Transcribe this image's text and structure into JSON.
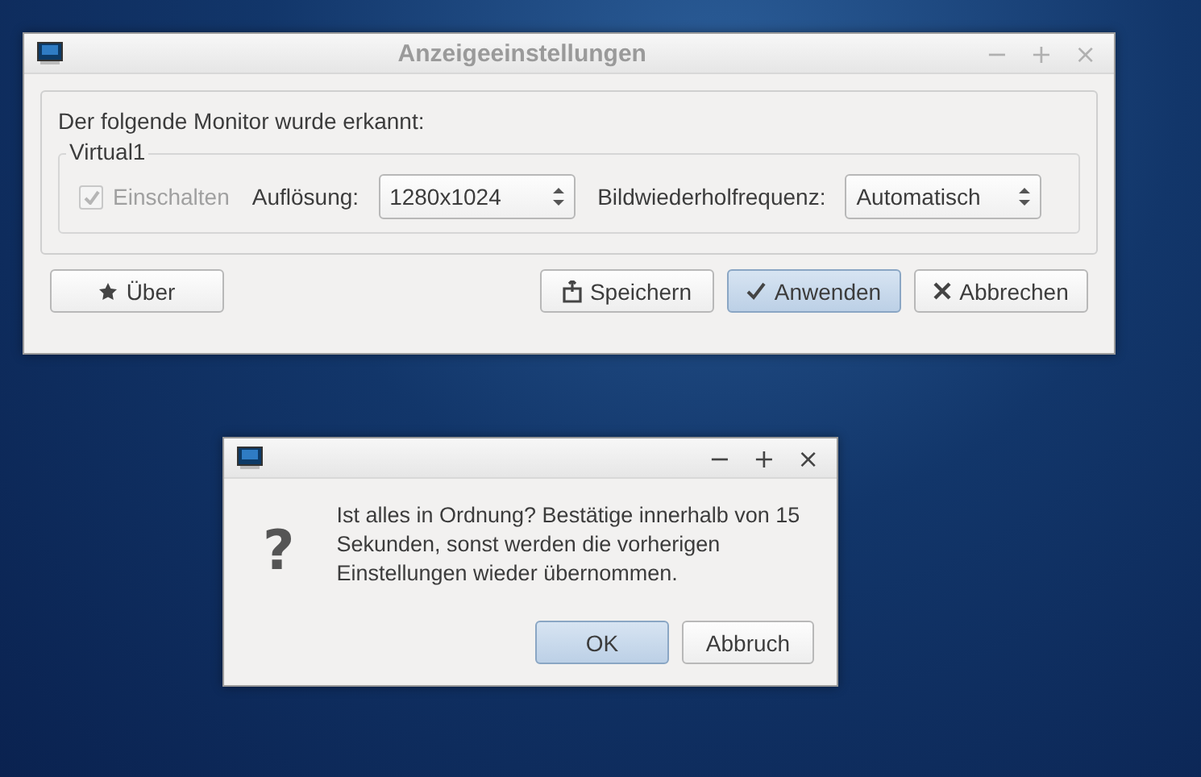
{
  "main_window": {
    "title": "Anzeigeeinstellungen",
    "window_controls": [
      "−",
      "+",
      "×"
    ],
    "detected_label": "Der folgende Monitor wurde erkannt:",
    "monitor": {
      "name": "Virtual1",
      "enable": {
        "label": "Einschalten",
        "checked": true,
        "disabled": true
      },
      "resolution": {
        "label": "Auflösung:",
        "value": "1280x1024"
      },
      "refresh_rate": {
        "label": "Bildwiederholfrequenz:",
        "value": "Automatisch"
      }
    },
    "buttons": [
      {
        "kind": "about",
        "label": "Über",
        "default": false
      },
      {
        "kind": "save",
        "label": "Speichern",
        "default": false
      },
      {
        "kind": "apply",
        "label": "Anwenden",
        "default": true
      },
      {
        "kind": "cancel",
        "label": "Abbrechen",
        "default": false
      }
    ]
  },
  "confirm_dialog": {
    "window_controls": [
      "−",
      "+",
      "×"
    ],
    "icon": "?",
    "message": "Ist alles in Ordnung? Bestätige innerhalb von 15 Sekunden, sonst werden die vorherigen Einstellungen wieder übernommen.",
    "buttons": [
      {
        "label": "OK",
        "default": true
      },
      {
        "label": "Abbruch",
        "default": false
      }
    ]
  }
}
